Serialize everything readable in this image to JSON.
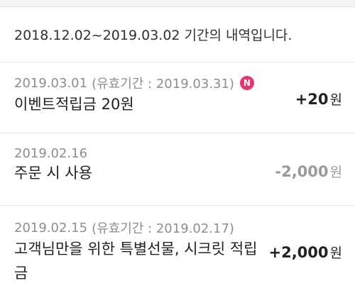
{
  "header": {
    "period_text": "2018.12.02~2019.03.02 기간의 내역입니다."
  },
  "entries": [
    {
      "date": "2019.03.01",
      "validity": "(유효기간 : 2019.03.31)",
      "badge": "N",
      "title": "이벤트적립금 20원",
      "amount": "+20",
      "unit": "원"
    },
    {
      "date": "2019.02.16",
      "validity": "",
      "badge": "",
      "title": "주문 시 사용",
      "amount": "-2,000",
      "unit": "원"
    },
    {
      "date": "2019.02.15",
      "validity": "(유효기간 : 2019.02.17)",
      "badge": "",
      "title": "고객님만을 위한 특별선물, 시크릿 적립금",
      "amount": "+2,000",
      "unit": "원"
    }
  ],
  "colors": {
    "badge": "#e8336b",
    "muted": "#8e8e8e",
    "text": "#222222"
  }
}
